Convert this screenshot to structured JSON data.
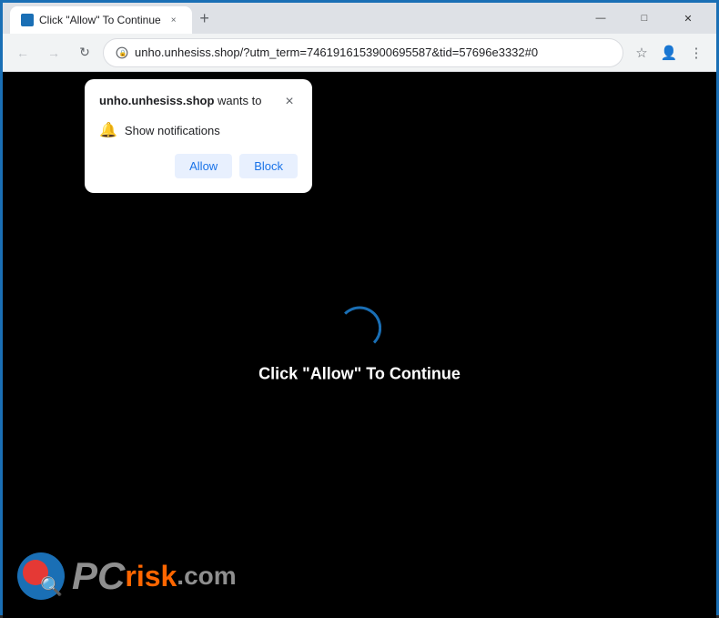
{
  "titlebar": {
    "tab": {
      "title": "Click \"Allow\" To Continue",
      "close_label": "×"
    },
    "new_tab_label": "+",
    "window_controls": {
      "minimize": "—",
      "maximize": "□",
      "close": "✕"
    }
  },
  "addressbar": {
    "nav": {
      "back": "←",
      "forward": "→",
      "refresh": "↻"
    },
    "url": "unho.unhesiss.shop/?utm_term=7461916153900695587&tid=57696e3332#0",
    "bookmark_icon": "☆",
    "profile_icon": "👤",
    "menu_icon": "⋮"
  },
  "popup": {
    "title_normal": "wants to",
    "title_bold": "unho.unhesiss.shop",
    "close_label": "×",
    "notification_text": "Show notifications",
    "allow_label": "Allow",
    "block_label": "Block"
  },
  "page": {
    "click_text": "Click \"Allow\" To Continue",
    "spinner_visible": true
  },
  "watermark": {
    "pc_text": "PC",
    "risk_text": "risk",
    "dotcom_text": ".com"
  }
}
